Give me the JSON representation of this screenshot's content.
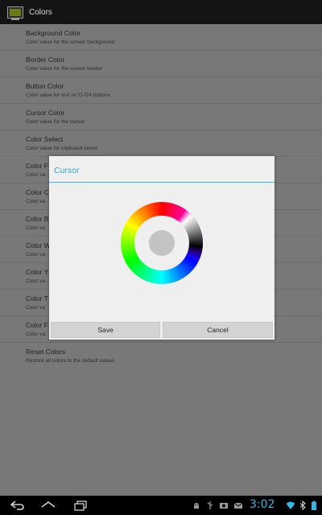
{
  "app": {
    "title": "Colors"
  },
  "preferences": [
    {
      "title": "Background Color",
      "summary": "Color value for the screen background"
    },
    {
      "title": "Border Color",
      "summary": "Color value for the screen border"
    },
    {
      "title": "Button Color",
      "summary": "Color value for text on f1-f24 buttons"
    },
    {
      "title": "Cursor Color",
      "summary": "Color value for the cursor"
    },
    {
      "title": "Color Select",
      "summary": "Color value for clipboard select"
    },
    {
      "title": "Color F",
      "summary": "Color va"
    },
    {
      "title": "Color C",
      "summary": "Color va"
    },
    {
      "title": "Color B",
      "summary": "Color va"
    },
    {
      "title": "Color W",
      "summary": "Color va"
    },
    {
      "title": "Color Y",
      "summary": "Color va"
    },
    {
      "title": "Color T",
      "summary": "Color va"
    },
    {
      "title": "Color F",
      "summary": "Color va"
    },
    {
      "title": "Reset Colors",
      "summary": "Restore all colors to the default values"
    }
  ],
  "dialog": {
    "title": "Cursor",
    "save_label": "Save",
    "cancel_label": "Cancel",
    "selected_color": "#c3c3c3"
  },
  "status_bar": {
    "time": "3:02"
  },
  "colors": {
    "accent": "#33b5e5",
    "title_bar": "#141414"
  }
}
